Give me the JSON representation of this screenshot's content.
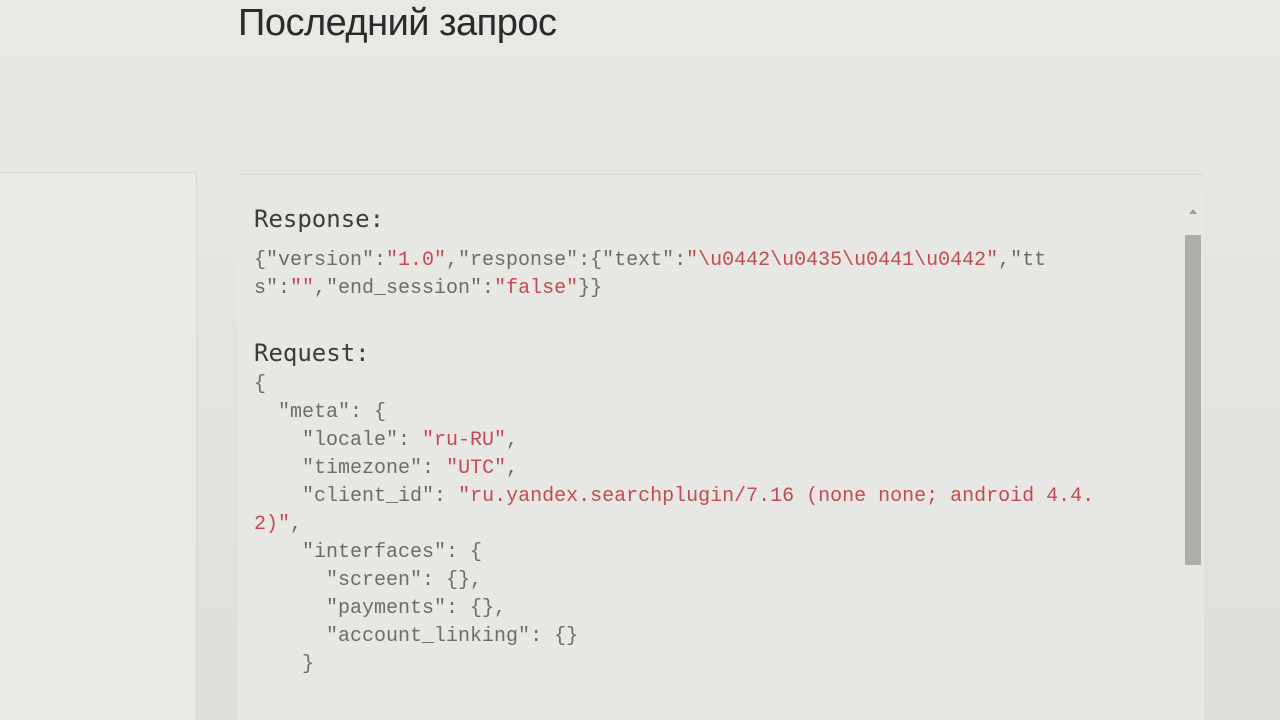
{
  "page": {
    "title": "Последний запрос"
  },
  "log": {
    "response_label": "Response:",
    "response_parts": [
      {
        "t": "{\"version\":",
        "c": "punc"
      },
      {
        "t": "\"1.0\"",
        "c": "str"
      },
      {
        "t": ",\"response\":{\"text\":",
        "c": "punc"
      },
      {
        "t": "\"\\u0442\\u0435\\u0441\\u0442\"",
        "c": "str"
      },
      {
        "t": ",\"tts\":",
        "c": "punc"
      },
      {
        "t": "\"\"",
        "c": "str"
      },
      {
        "t": ",\"end_session\":",
        "c": "punc"
      },
      {
        "t": "\"false\"",
        "c": "str"
      },
      {
        "t": "}}",
        "c": "punc"
      }
    ],
    "request_label": "Request:",
    "request_parts": [
      {
        "t": "{\n  ",
        "c": "punc"
      },
      {
        "t": "\"meta\"",
        "c": "key"
      },
      {
        "t": ": {\n    ",
        "c": "punc"
      },
      {
        "t": "\"locale\"",
        "c": "key"
      },
      {
        "t": ": ",
        "c": "punc"
      },
      {
        "t": "\"ru-RU\"",
        "c": "str"
      },
      {
        "t": ",\n    ",
        "c": "punc"
      },
      {
        "t": "\"timezone\"",
        "c": "key"
      },
      {
        "t": ": ",
        "c": "punc"
      },
      {
        "t": "\"UTC\"",
        "c": "str"
      },
      {
        "t": ",\n    ",
        "c": "punc"
      },
      {
        "t": "\"client_id\"",
        "c": "key"
      },
      {
        "t": ": ",
        "c": "punc"
      },
      {
        "t": "\"ru.yandex.searchplugin/7.16 (none none; android 4.4.2)\"",
        "c": "str"
      },
      {
        "t": ",\n    ",
        "c": "punc"
      },
      {
        "t": "\"interfaces\"",
        "c": "key"
      },
      {
        "t": ": {\n      ",
        "c": "punc"
      },
      {
        "t": "\"screen\"",
        "c": "key"
      },
      {
        "t": ": {},\n      ",
        "c": "punc"
      },
      {
        "t": "\"payments\"",
        "c": "key"
      },
      {
        "t": ": {},\n      ",
        "c": "punc"
      },
      {
        "t": "\"account_linking\"",
        "c": "key"
      },
      {
        "t": ": {}\n    }",
        "c": "punc"
      }
    ]
  },
  "colors": {
    "string": "#c44a55",
    "key": "#6b6d6c",
    "label": "#3c3c3c"
  }
}
